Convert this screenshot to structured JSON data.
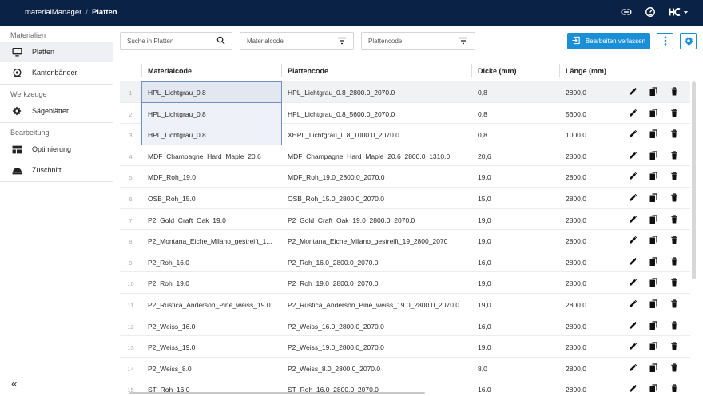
{
  "app": {
    "name": "materialManager",
    "separator": "/",
    "page": "Platten"
  },
  "sidebar": {
    "sections": [
      {
        "title": "Materialien",
        "items": [
          {
            "label": "Platten",
            "icon": "monitor-icon",
            "active": true
          },
          {
            "label": "Kantenbänder",
            "icon": "tape-roll-icon",
            "active": false
          }
        ]
      },
      {
        "title": "Werkzeuge",
        "items": [
          {
            "label": "Sägeblätter",
            "icon": "saw-blade-icon",
            "active": false
          }
        ]
      },
      {
        "title": "Bearbeitung",
        "items": [
          {
            "label": "Optimierung",
            "icon": "layout-icon",
            "active": false
          },
          {
            "label": "Zuschnitt",
            "icon": "cutting-icon",
            "active": false
          }
        ]
      }
    ],
    "collapse_label": "«"
  },
  "toolbar": {
    "search_placeholder": "Suche in Platten",
    "filter1_placeholder": "Materialcode",
    "filter2_placeholder": "Plattencode",
    "edit_exit_label": "Bearbeiten verlassen"
  },
  "table": {
    "columns": [
      "Materialcode",
      "Plattencode",
      "Dicke (mm)",
      "Länge (mm)"
    ],
    "rows": [
      {
        "n": "1",
        "material": "HPL_Lichtgrau_0.8",
        "platte": "HPL_Lichtgrau_0.8_2800.0_2070.0",
        "dicke": "0,8",
        "laenge": "2800,0"
      },
      {
        "n": "2",
        "material": "HPL_Lichtgrau_0.8",
        "platte": "HPL_Lichtgrau_0.8_5600.0_2070.0",
        "dicke": "0,8",
        "laenge": "5600,0"
      },
      {
        "n": "3",
        "material": "HPL_Lichtgrau_0.8",
        "platte": "XHPL_Lichtgrau_0.8_1000.0_2070.0",
        "dicke": "0,8",
        "laenge": "1000,0"
      },
      {
        "n": "4",
        "material": "MDF_Champagne_Hard_Maple_20.6",
        "platte": "MDF_Champagne_Hard_Maple_20.6_2800.0_1310.0",
        "dicke": "20,6",
        "laenge": "2800,0"
      },
      {
        "n": "5",
        "material": "MDF_Roh_19.0",
        "platte": "MDF_Roh_19.0_2800.0_2070.0",
        "dicke": "19,0",
        "laenge": "2800,0"
      },
      {
        "n": "6",
        "material": "OSB_Roh_15.0",
        "platte": "OSB_Roh_15.0_2800.0_2070.0",
        "dicke": "15,0",
        "laenge": "2800,0"
      },
      {
        "n": "7",
        "material": "P2_Gold_Craft_Oak_19.0",
        "platte": "P2_Gold_Craft_Oak_19.0_2800.0_2070.0",
        "dicke": "19,0",
        "laenge": "2800,0"
      },
      {
        "n": "8",
        "material": "P2_Montana_Eiche_Milano_gestreift_1...",
        "platte": "P2_Montana_Eiche_Milano_gestreift_19_2800_2070",
        "dicke": "19,0",
        "laenge": "2800,0"
      },
      {
        "n": "9",
        "material": "P2_Roh_16.0",
        "platte": "P2_Roh_16.0_2800.0_2070.0",
        "dicke": "16,0",
        "laenge": "2800,0"
      },
      {
        "n": "10",
        "material": "P2_Roh_19.0",
        "platte": "P2_Roh_19.0_2800.0_2070.0",
        "dicke": "19,0",
        "laenge": "2800,0"
      },
      {
        "n": "11",
        "material": "P2_Rustica_Anderson_Pine_weiss_19.0",
        "platte": "P2_Rustica_Anderson_Pine_weiss_19.0_2800.0_2070.0",
        "dicke": "19,0",
        "laenge": "2800,0"
      },
      {
        "n": "12",
        "material": "P2_Weiss_16.0",
        "platte": "P2_Weiss_16.0_2800.0_2070.0",
        "dicke": "16,0",
        "laenge": "2800,0"
      },
      {
        "n": "13",
        "material": "P2_Weiss_19.0",
        "platte": "P2_Weiss_19.0_2800.0_2070.0",
        "dicke": "19,0",
        "laenge": "2800,0"
      },
      {
        "n": "14",
        "material": "P2_Weiss_8.0",
        "platte": "P2_Weiss_8.0_2800.0_2070.0",
        "dicke": "8,0",
        "laenge": "2800,0"
      },
      {
        "n": "15",
        "material": "ST_Roh_16.0",
        "platte": "ST_Roh_16.0_2800.0_2070.0",
        "dicke": "16,0",
        "laenge": "2800,0"
      }
    ]
  },
  "colors": {
    "topbar": "#0a2245",
    "accent": "#1b8fd6",
    "selection_border": "#6f8fc4"
  }
}
